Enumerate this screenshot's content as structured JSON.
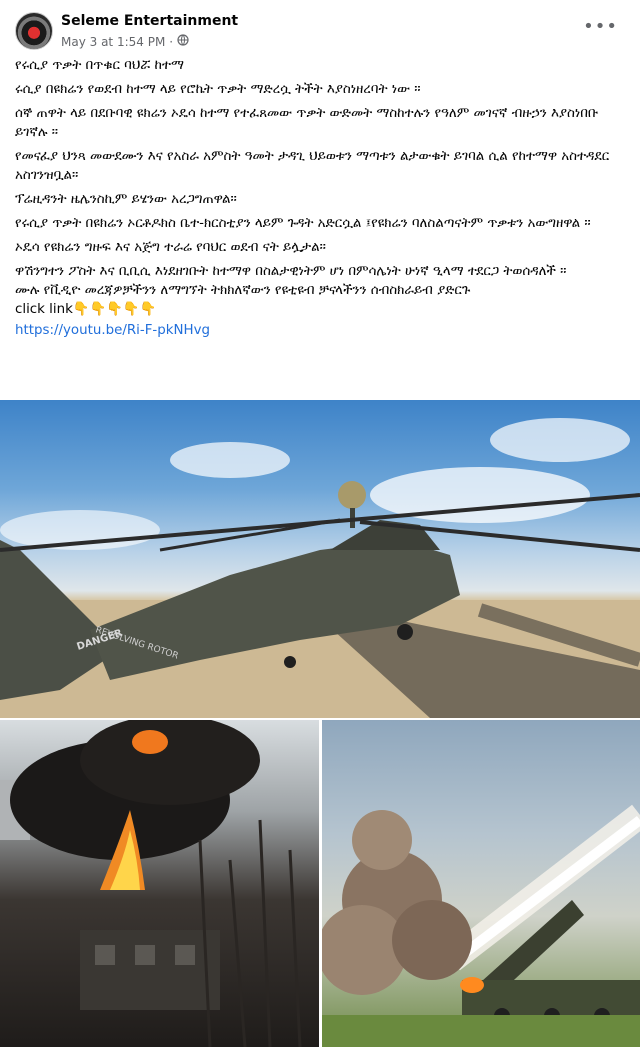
{
  "post": {
    "page_name": "Seleme Entertainment",
    "timestamp": "May 3 at 1:54 PM",
    "separator": "·",
    "audience_icon": "globe-icon",
    "more_label": "•••",
    "paragraphs": [
      "የሩሲያ ጥቃት በጥቁር ባህሯ ከተማ",
      "ሩሲያ በዩክሬን የወደብ ከተማ ላይ የሮኬት ጥቃት ማድረሷ ትችት እያስነዘረባት ነው ።",
      "ሰኞ ጠዋት ላይ በደቡባዊ ዩክሬን ኦዴሳ ከተማ የተፈጸመው ጥቃት ውድመት ማስከተሉን የዓለም መገናኛ ብዙኃን እያስነበቡ ይገኛሉ ።",
      " የመናፈያ ህንጻ መውደሙን እና የአስራ አምስት ዓመት ታዳጊ ህይወቱን ማጣቱን ልታውቁት ይገባል ሲል የከተማዋ አስተዳደር አስገንዝቧል።",
      "ፕሬዚዳንት ዜሌንስኪም ይሄንው አረጋግጠዋል።",
      "የሩሲያ ጥቃት በዩክሬን ኦርቶዶክስ ቤተ-ክርስቲያን ላይም ጉዳት አድርሷል ፤የዩክሬን ባለስልጣናትም ጥቃቱን አውግዘዋል ።",
      "ኦዴሳ የዩክሬን ግዙፍ እና አጅግ ተራሬ የባህር ወደብ ናት ይሏታል።",
      "ዋሽንግተን ፖስት እና ቢቢሲ እነደዘገቡት ከተማዋ በስልታዊነትም ሆነ በምሳሌነት ሁነኛ ዒላማ ተደርጋ ትወሰዳለች ።\nሙሉ የቪዲዮ መረጃዎቻችንን ለማግኘት ትክክለኛውን የዩቲዩብ ቻናላችንን ሰብስክራይብ ያድርጉ\nclick link👇👇👇👇👇"
    ],
    "link": "https://youtu.be/Ri-F-pkNHvg",
    "photos": [
      {
        "name": "helicopter-photo",
        "helicopter_text_1": "REVOLVING ROTOR",
        "helicopter_text_2": "DANGER"
      },
      {
        "name": "fire-photo"
      },
      {
        "name": "rocket-launch-photo"
      }
    ]
  },
  "colors": {
    "link": "#216fdb",
    "meta": "#65676b",
    "text": "#050505"
  }
}
